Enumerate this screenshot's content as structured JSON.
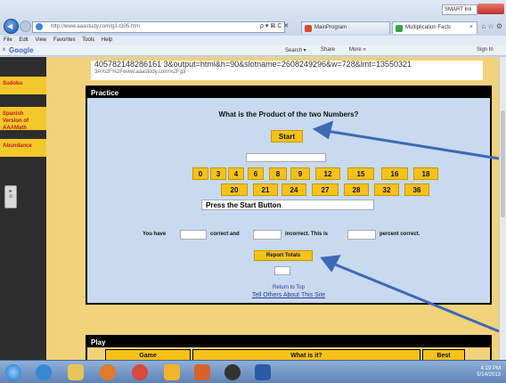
{
  "browser": {
    "address": "http://www.aaastudy.com/g3-t305.htm",
    "address_tools": "ρ ▾ ⊠ C ✕",
    "tabs": [
      {
        "label": "MainProgram"
      },
      {
        "label": "Multiplication Facts"
      }
    ],
    "smart_ink": "SMART Ink",
    "menu": [
      "File",
      "Edit",
      "View",
      "Favorites",
      "Tools",
      "Help"
    ],
    "google": {
      "close": "x",
      "logo": "Google",
      "search": "Search ▾",
      "share": "Share",
      "more": "More »",
      "signin": "Sign In"
    }
  },
  "page": {
    "code_line1": "405782148286161 3&output=html&h=90&slotname=2608249296&w=728&lmt=13550321",
    "code_line2": "3A%2F%2Fwww.aaastudy.com%2Fg3",
    "sidebar": [
      {
        "label": "Sudoku"
      },
      {
        "label": "Spanish Version of AAAMath"
      },
      {
        "label": "Abundance"
      }
    ],
    "practice": {
      "heading": "Practice",
      "question": "What is the Product of the two Numbers?",
      "start_label": "Start",
      "numbers_row1": [
        "0",
        "3",
        "4",
        "6",
        "8",
        "9",
        "12",
        "15",
        "16",
        "18"
      ],
      "numbers_row2": [
        "20",
        "21",
        "24",
        "27",
        "28",
        "32",
        "36"
      ],
      "message": "Press the Start Button",
      "score_you_have": "You have",
      "score_correct": "correct and",
      "score_incorrect": "incorrect.  This is",
      "score_percent": "percent correct.",
      "report_label": "Report Totals",
      "return_top": "Return to Top",
      "tell_others": "Tell Others About This Site"
    },
    "play": {
      "heading": "Play",
      "col_game": "Game",
      "col_what": "What is it?",
      "col_best": "Best"
    }
  },
  "taskbar": {
    "time": "4:19 PM",
    "date": "5/14/2013"
  },
  "colors": {
    "gold": "#f6c21a",
    "panel_blue": "#c7daef",
    "arrow_blue": "#3f68b5"
  }
}
